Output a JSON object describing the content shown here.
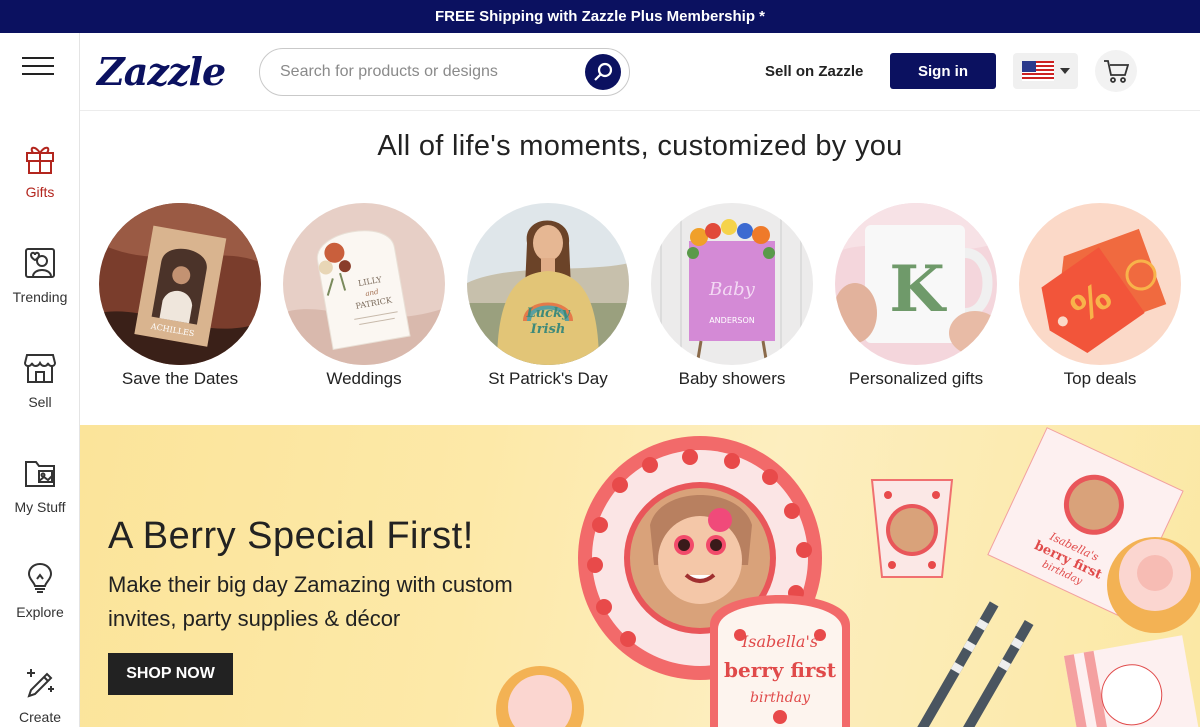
{
  "promo": {
    "text": "FREE Shipping with Zazzle Plus Membership *"
  },
  "header": {
    "logo": "Zazzle",
    "search_placeholder": "Search for products or designs",
    "sell_label": "Sell on Zazzle",
    "signin_label": "Sign in"
  },
  "sidebar": {
    "items": [
      {
        "label": "Gifts",
        "icon": "gift-icon"
      },
      {
        "label": "Trending",
        "icon": "trending-icon"
      },
      {
        "label": "Sell",
        "icon": "store-icon"
      },
      {
        "label": "My Stuff",
        "icon": "folder-icon"
      },
      {
        "label": "Explore",
        "icon": "lightbulb-icon"
      },
      {
        "label": "Create",
        "icon": "magic-pen-icon"
      }
    ]
  },
  "main": {
    "headline": "All of life's moments, customized by you",
    "categories": [
      {
        "label": "Save the Dates",
        "card_name": "ACHILLES"
      },
      {
        "label": "Weddings",
        "card_line1": "LILLY",
        "card_line2": "and",
        "card_line3": "PATRICK"
      },
      {
        "label": "St Patrick's Day",
        "shirt_line1": "Lucky",
        "shirt_line2": "Irish"
      },
      {
        "label": "Baby showers",
        "sign_script": "Baby",
        "sign_name": "ANDERSON"
      },
      {
        "label": "Personalized gifts",
        "mug_letter": "K"
      },
      {
        "label": "Top deals",
        "tag_symbol": "%"
      }
    ]
  },
  "hero": {
    "title": "A Berry Special First!",
    "subtitle": "Make their big day Zamazing with custom invites, party supplies & décor",
    "cta": "SHOP NOW",
    "invite_line1": "Isabella's",
    "invite_line2": "berry first",
    "invite_line3": "birthday",
    "napkin_line1": "Isabella's",
    "napkin_line2": "berry first",
    "napkin_line3": "birthday"
  },
  "colors": {
    "brand": "#0b1160",
    "accent_red": "#b3261e"
  }
}
